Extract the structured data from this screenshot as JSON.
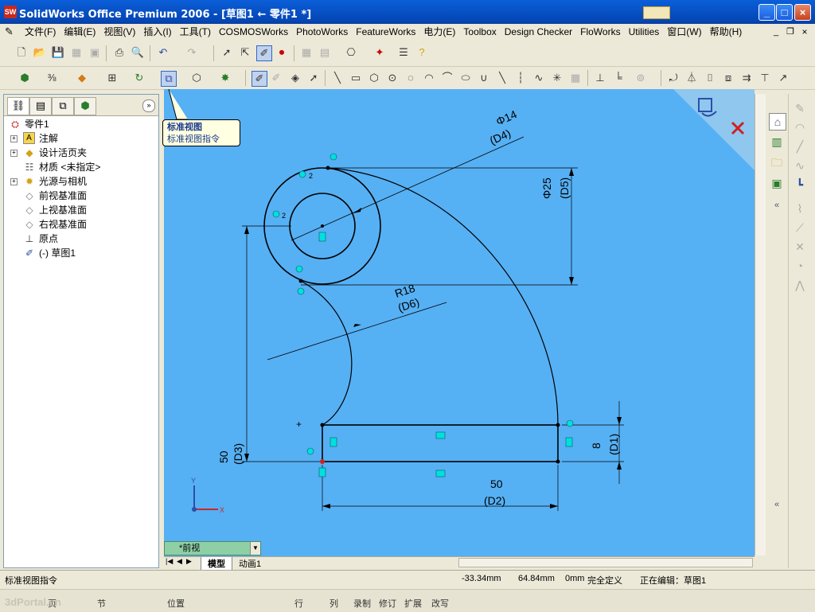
{
  "window": {
    "title": "SolidWorks Office Premium 2006 - [草图1 ← 零件1 *]",
    "minimize": "_",
    "maximize": "□",
    "close": "×"
  },
  "menu": [
    "文件(F)",
    "编辑(E)",
    "视图(V)",
    "插入(I)",
    "工具(T)",
    "COSMOSWorks",
    "PhotoWorks",
    "FeatureWorks",
    "电力(E)",
    "Toolbox",
    "Design Checker",
    "FloWorks",
    "Utilities",
    "窗口(W)",
    "帮助(H)"
  ],
  "tree": {
    "root": "零件1",
    "items": [
      {
        "label": "注解",
        "expand": "+"
      },
      {
        "label": "设计活页夹",
        "expand": "+"
      },
      {
        "label": "材质 <未指定>",
        "expand": ""
      },
      {
        "label": "光源与相机",
        "expand": "+"
      },
      {
        "label": "前视基准面",
        "expand": ""
      },
      {
        "label": "上视基准面",
        "expand": ""
      },
      {
        "label": "右视基准面",
        "expand": ""
      },
      {
        "label": "原点",
        "expand": ""
      },
      {
        "label": "(-) 草图1",
        "expand": ""
      }
    ]
  },
  "tooltip": {
    "title": "标准视图",
    "desc": "标准视图指令"
  },
  "sketch": {
    "dim_d4": "Φ14",
    "dim_d4_name": "(D4)",
    "dim_d5": "Φ25",
    "dim_d5_name": "(D5)",
    "dim_d6": "R18",
    "dim_d6_name": "(D6)",
    "dim_d3": "50",
    "dim_d3_name": "(D3)",
    "dim_d1": "8",
    "dim_d1_name": "(D1)",
    "dim_d2": "50",
    "dim_d2_name": "(D2)",
    "axis_y": "Y",
    "axis_x": "X",
    "relation_2": "2"
  },
  "view_select": "*前视",
  "tabs": {
    "model": "模型",
    "animation": "动画1"
  },
  "status": {
    "hint": "标准视图指令",
    "x": "-33.34mm",
    "y": "64.84mm",
    "z": "0mm",
    "state": "完全定义",
    "editing": "正在编辑：草图1"
  },
  "status2": [
    "页",
    "节",
    "位置",
    "行",
    "列",
    "录制",
    "修订",
    "扩展",
    "改写"
  ],
  "watermark": "3dPortal.cn"
}
